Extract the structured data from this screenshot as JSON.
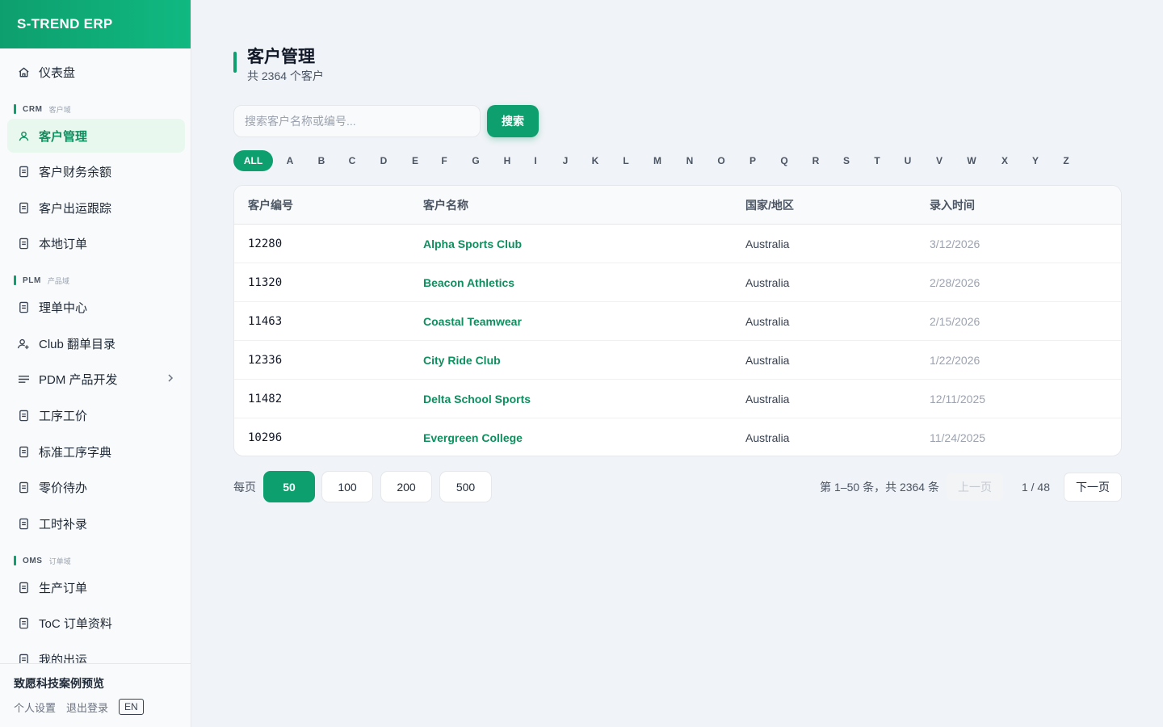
{
  "app": {
    "brand": "S-TREND ERP"
  },
  "sidebar": {
    "dashboard": {
      "label": "仪表盘",
      "icon": "home-icon"
    },
    "sections": [
      {
        "en": "CRM",
        "zh": "客户域"
      },
      {
        "en": "PLM",
        "zh": "产品域"
      },
      {
        "en": "OMS",
        "zh": "订单域"
      }
    ],
    "crm_items": [
      {
        "label": "客户管理",
        "icon": "user-icon",
        "active": true
      },
      {
        "label": "客户财务余额",
        "icon": "document-icon"
      },
      {
        "label": "客户出运跟踪",
        "icon": "document-icon"
      },
      {
        "label": "本地订单",
        "icon": "document-icon"
      }
    ],
    "plm_items": [
      {
        "label": "理单中心",
        "icon": "document-icon"
      },
      {
        "label": "Club 翻单目录",
        "icon": "user-add-icon"
      },
      {
        "label": "PDM 产品开发",
        "icon": "menu-icon",
        "expandable": true
      },
      {
        "label": "工序工价",
        "icon": "document-icon"
      },
      {
        "label": "标准工序字典",
        "icon": "document-icon"
      },
      {
        "label": "零价待办",
        "icon": "document-icon"
      },
      {
        "label": "工时补录",
        "icon": "document-icon"
      }
    ],
    "oms_items": [
      {
        "label": "生产订单",
        "icon": "document-icon"
      },
      {
        "label": "ToC 订单资料",
        "icon": "document-icon"
      },
      {
        "label": "我的出运",
        "icon": "document-icon"
      }
    ],
    "footer": {
      "title": "致愿科技案例预览",
      "settings": "个人设置",
      "logout": "退出登录",
      "lang": "EN"
    }
  },
  "main": {
    "title": "客户管理",
    "subtitle": "共 2364 个客户",
    "search": {
      "placeholder": "搜索客户名称或编号...",
      "button": "搜索"
    },
    "letters": [
      "ALL",
      "A",
      "B",
      "C",
      "D",
      "E",
      "F",
      "G",
      "H",
      "I",
      "J",
      "K",
      "L",
      "M",
      "N",
      "O",
      "P",
      "Q",
      "R",
      "S",
      "T",
      "U",
      "V",
      "W",
      "X",
      "Y",
      "Z"
    ],
    "active_letter": "ALL",
    "table": {
      "headers": [
        "客户编号",
        "客户名称",
        "国家/地区",
        "录入时间"
      ],
      "rows": [
        {
          "code": "12280",
          "name": "Alpha Sports Club",
          "country": "Australia",
          "date": "3/12/2026"
        },
        {
          "code": "11320",
          "name": "Beacon Athletics",
          "country": "Australia",
          "date": "2/28/2026"
        },
        {
          "code": "11463",
          "name": "Coastal Teamwear",
          "country": "Australia",
          "date": "2/15/2026"
        },
        {
          "code": "12336",
          "name": "City Ride Club",
          "country": "Australia",
          "date": "1/22/2026"
        },
        {
          "code": "11482",
          "name": "Delta School Sports",
          "country": "Australia",
          "date": "12/11/2025"
        },
        {
          "code": "10296",
          "name": "Evergreen College",
          "country": "Australia",
          "date": "11/24/2025"
        }
      ]
    },
    "pager": {
      "per_page_label": "每页",
      "sizes": [
        "50",
        "100",
        "200",
        "500"
      ],
      "active_size": "50",
      "range": "第 1–50 条，共 2364 条",
      "prev": "上一页",
      "page_indicator": "1 / 48",
      "next": "下一页"
    }
  },
  "colors": {
    "accent": "#0e9f6e",
    "accent_light": "#e8f8ef",
    "link": "#0f8f5f"
  }
}
